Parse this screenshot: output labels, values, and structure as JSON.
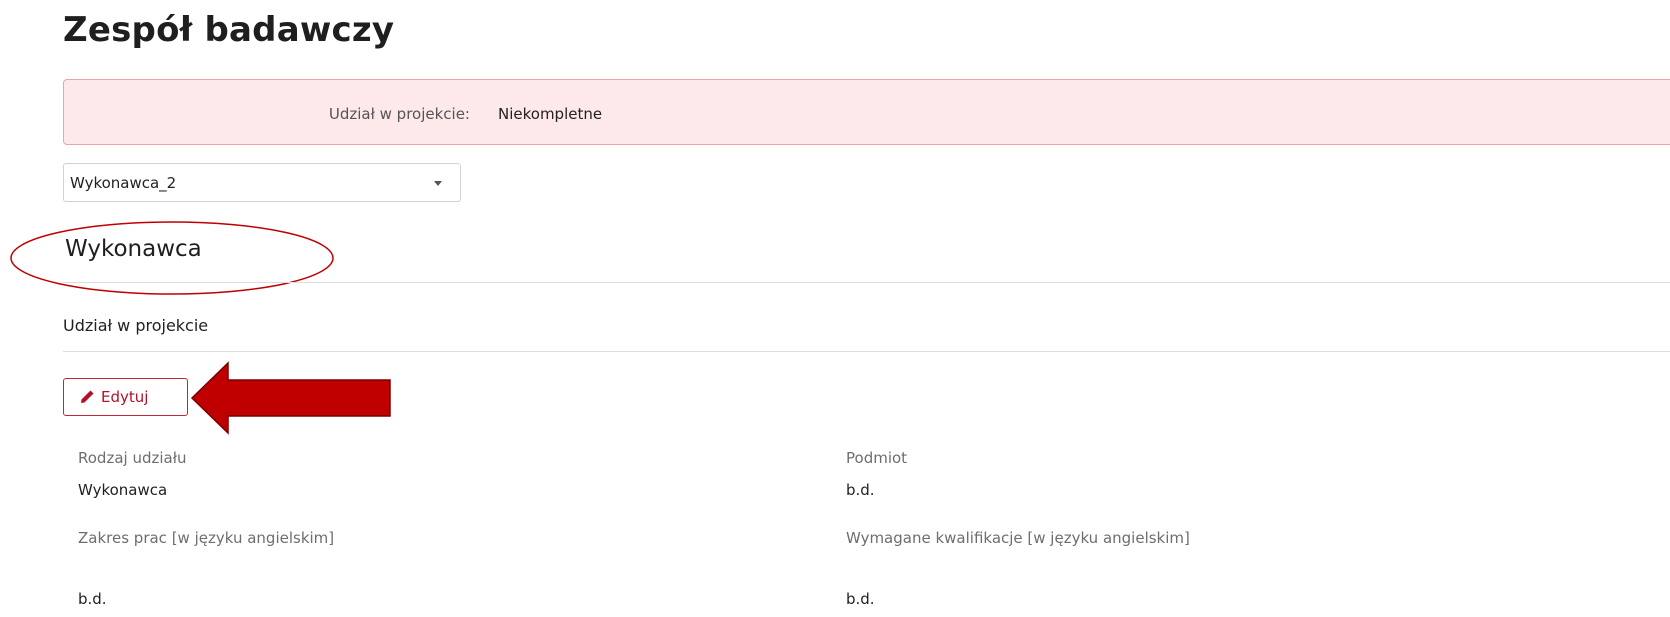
{
  "page": {
    "title": "Zespół badawczy"
  },
  "status": {
    "label": "Udział w projekcie:",
    "value": "Niekompletne"
  },
  "selector": {
    "value": "Wykonawca_2",
    "icon": "caret-down-icon"
  },
  "section": {
    "title": "Wykonawca",
    "subtitle": "Udział w projekcie"
  },
  "actions": {
    "edit_label": "Edytuj",
    "edit_icon": "pencil-icon"
  },
  "fields": [
    {
      "label": "Rodzaj udziału",
      "value": "Wykonawca"
    },
    {
      "label": "Podmiot",
      "value": "b.d."
    },
    {
      "label": "Zakres prac [w języku angielskim]",
      "value": "b.d."
    },
    {
      "label": "Wymagane kwalifikacje [w języku angielskim]",
      "value": "b.d."
    }
  ],
  "colors": {
    "banner_bg": "#fde8ea",
    "banner_border": "#e8a4aa",
    "accent": "#b11226",
    "annotation_red": "#c00000"
  }
}
